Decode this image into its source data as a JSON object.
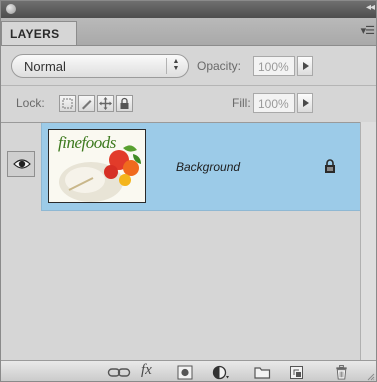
{
  "panel": {
    "tab_label": "LAYERS"
  },
  "blend": {
    "mode": "Normal",
    "opacity_label": "Opacity:",
    "opacity_value": "100%"
  },
  "lock": {
    "label": "Lock:",
    "fill_label": "Fill:",
    "fill_value": "100%"
  },
  "layers": [
    {
      "name": "Background",
      "thumbnail_text": "finefoods",
      "visible": true,
      "locked": true
    }
  ],
  "footer_icons": [
    "link-layers-icon",
    "fx-icon",
    "add-mask-icon",
    "adjustment-layer-icon",
    "new-group-icon",
    "new-layer-icon",
    "trash-icon"
  ],
  "colors": {
    "selected_row": "#9ccbe8",
    "panel_bg": "#d6d6d6"
  }
}
